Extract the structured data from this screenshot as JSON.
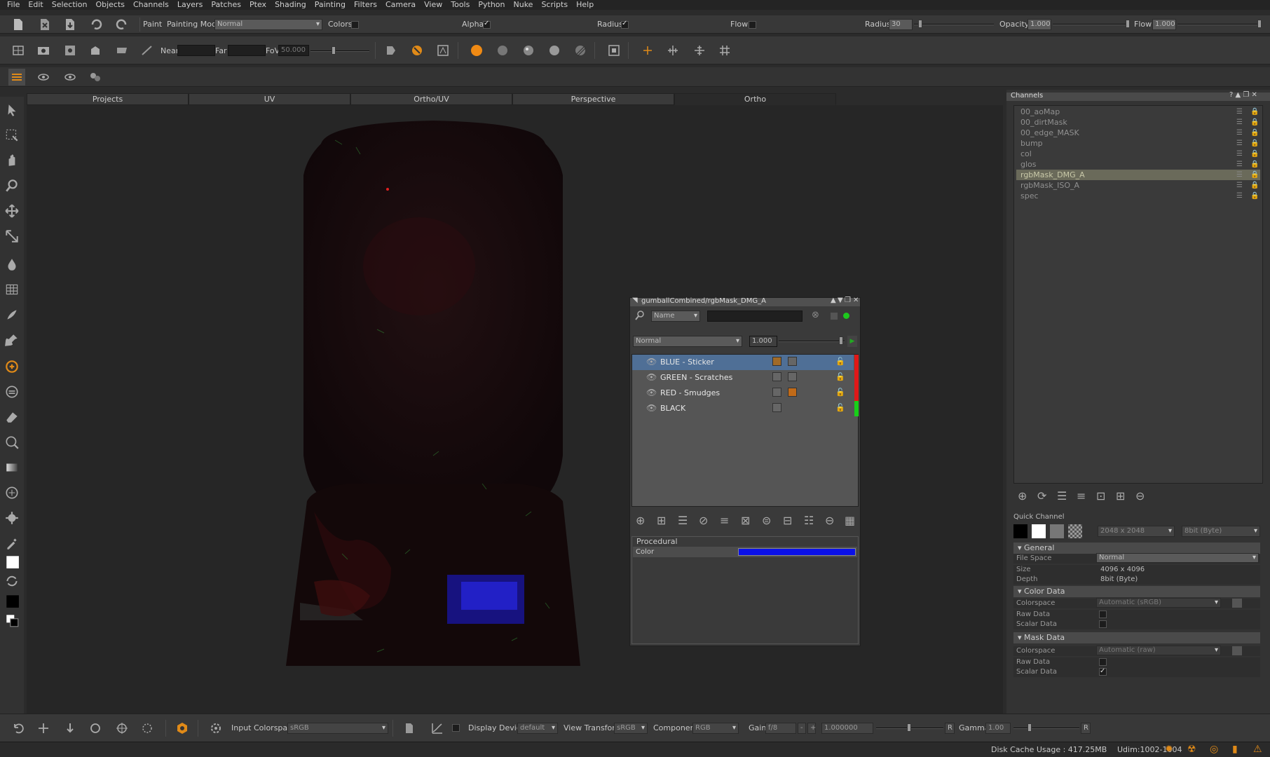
{
  "menu": [
    "File",
    "Edit",
    "Selection",
    "Objects",
    "Channels",
    "Layers",
    "Patches",
    "Ptex",
    "Shading",
    "Painting",
    "Filters",
    "Camera",
    "View",
    "Tools",
    "Python",
    "Nuke",
    "Scripts",
    "Help"
  ],
  "toolbar1": {
    "paint_label": "Paint",
    "painting_mode_label": "Painting Mode",
    "painting_mode_value": "Normal",
    "colors_label": "Colors",
    "alpha_label": "Alpha",
    "radius_chk_label": "Radius",
    "flow_chk_label": "Flow",
    "radius_label": "Radius",
    "radius_value": "30",
    "opacity_label": "Opacity",
    "opacity_value": "1.000",
    "flow_label": "Flow",
    "flow_value": "1.000"
  },
  "toolbar2": {
    "near_label": "Near",
    "far_label": "Far",
    "fov_label": "FoV",
    "fov_value": "50.000"
  },
  "view_tabs": [
    "Projects",
    "UV",
    "Ortho/UV",
    "Perspective",
    "Ortho"
  ],
  "active_tab": "Ortho",
  "layer_panel": {
    "title": "gumballCombined/rgbMask_DMG_A",
    "filter_mode": "Name",
    "blend_mode": "Normal",
    "opacity": "1.000",
    "layers": [
      {
        "name": "BLUE - Sticker",
        "selected": true
      },
      {
        "name": "GREEN - Scratches",
        "selected": false
      },
      {
        "name": "RED - Smudges",
        "selected": false
      },
      {
        "name": "BLACK",
        "selected": false
      }
    ],
    "procedural_label": "Procedural",
    "color_label": "Color",
    "color_value": "#0a10e8"
  },
  "channels": {
    "title": "Channels",
    "items": [
      "00_aoMap",
      "00_dirtMask",
      "00_edge_MASK",
      "bump",
      "col",
      "glos",
      "rgbMask_DMG_A",
      "rgbMask_ISO_A",
      "spec"
    ],
    "selected": "rgbMask_DMG_A",
    "quick_channel_label": "Quick Channel",
    "qc_size": "2048 x 2048",
    "qc_depth": "8bit (Byte)",
    "general_label": "General",
    "file_space_label": "File Space",
    "file_space_value": "Normal",
    "size_label": "Size",
    "size_value": "4096 x 4096",
    "depth_label": "Depth",
    "depth_value": "8bit (Byte)",
    "color_data_label": "Color Data",
    "colorspace_label": "Colorspace",
    "color_colorspace_value": "Automatic (sRGB)",
    "raw_data_label": "Raw Data",
    "scalar_data_label": "Scalar Data",
    "mask_data_label": "Mask Data",
    "mask_colorspace_value": "Automatic (raw)"
  },
  "bottom": {
    "input_colorspace_label": "Input Colorspace",
    "input_colorspace_value": "sRGB",
    "display_device_label": "Display Device",
    "display_device_value": "default",
    "view_transform_label": "View Transform",
    "view_transform_value": "sRGB",
    "component_label": "Component",
    "component_value": "RGB",
    "gain_label": "Gain",
    "gain_value": "f/8",
    "gain_num": "1.000000",
    "r_label": "R",
    "gamma_label": "Gamma",
    "gamma_value": "1.00",
    "r2_label": "R"
  },
  "status": {
    "disk_cache": "Disk Cache Usage : 417.25MB",
    "udim": "Udim:1002-1004"
  }
}
